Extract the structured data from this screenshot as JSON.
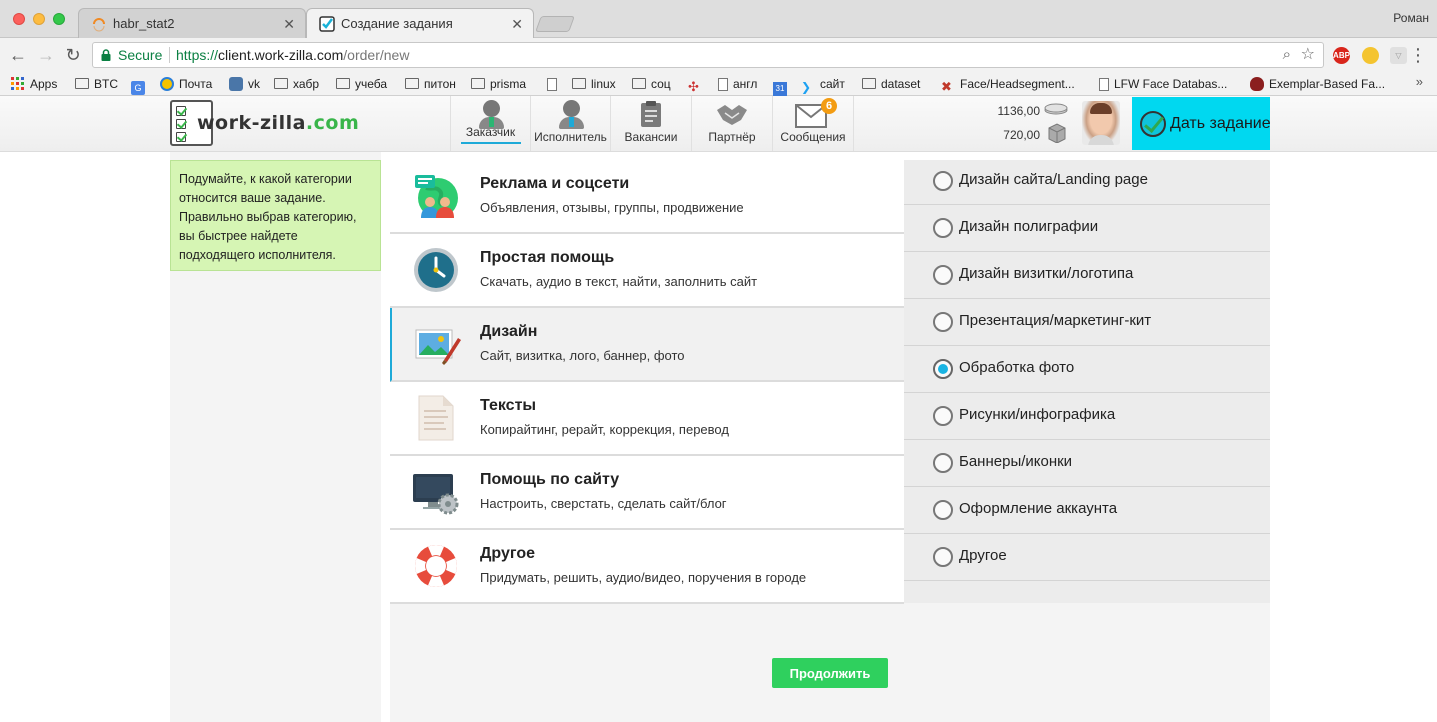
{
  "browser": {
    "tabs": [
      {
        "title": "habr_stat2"
      },
      {
        "title": "Создание задания"
      }
    ],
    "profile": "Роман",
    "address": {
      "secure_label": "Secure",
      "scheme": "https://",
      "host": "client.work-zilla.com",
      "path": "/order/new"
    },
    "bookmarks": [
      "Apps",
      "BTC",
      "Почта",
      "vk",
      "хабр",
      "учеба",
      "питон",
      "prisma",
      "linux",
      "соц",
      "англ",
      "сайт",
      "dataset",
      "Face/Headsegment...",
      "LFW Face Databas...",
      "Exemplar-Based Fa..."
    ],
    "bookmarks_more": "»",
    "extension_abp": "ABP"
  },
  "site": {
    "logo_text": "work-zilla",
    "logo_suffix": ".com",
    "nav": [
      {
        "label": "Заказчик",
        "icon": "customer-icon",
        "active": true
      },
      {
        "label": "Исполнитель",
        "icon": "freelancer-icon"
      },
      {
        "label": "Вакансии",
        "icon": "clipboard-icon"
      },
      {
        "label": "Партнёр",
        "icon": "handshake-icon"
      },
      {
        "label": "Сообщения",
        "icon": "envelope-icon",
        "badge": "6"
      }
    ],
    "balance": {
      "main": "1136,00",
      "reserved": "720,00"
    },
    "give_task_label": "Дать задание",
    "accent_color": "#00d8f0"
  },
  "hint": "Подумайте, к какой категории относится ваше задание. Правильно выбрав категорию, вы быстрее найдете подходящего исполнителя.",
  "categories": [
    {
      "title": "Реклама и соцсети",
      "desc": "Объявления, отзывы, группы, продвижение",
      "icon": "people-globe-icon"
    },
    {
      "title": "Простая помощь",
      "desc": "Скачать, аудио в текст, найти, заполнить сайт",
      "icon": "clock-icon"
    },
    {
      "title": "Дизайн",
      "desc": "Сайт, визитка, лого, баннер, фото",
      "icon": "picture-brush-icon",
      "selected": true
    },
    {
      "title": "Тексты",
      "desc": "Копирайтинг, рерайт, коррекция, перевод",
      "icon": "document-icon"
    },
    {
      "title": "Помощь по сайту",
      "desc": "Настроить, сверстать, сделать сайт/блог",
      "icon": "monitor-gear-icon"
    },
    {
      "title": "Другое",
      "desc": "Придумать, решить, аудио/видео, поручения в городе",
      "icon": "lifebuoy-icon"
    }
  ],
  "subcategories": [
    {
      "label": "Дизайн сайта/Landing page",
      "checked": false
    },
    {
      "label": "Дизайн полиграфии",
      "checked": false
    },
    {
      "label": "Дизайн визитки/логотипа",
      "checked": false
    },
    {
      "label": "Презентация/маркетинг-кит",
      "checked": false
    },
    {
      "label": "Обработка фото",
      "checked": true
    },
    {
      "label": "Рисунки/инфографика",
      "checked": false
    },
    {
      "label": "Баннеры/иконки",
      "checked": false
    },
    {
      "label": "Оформление аккаунта",
      "checked": false
    },
    {
      "label": "Другое",
      "checked": false
    }
  ],
  "continue_label": "Продолжить"
}
